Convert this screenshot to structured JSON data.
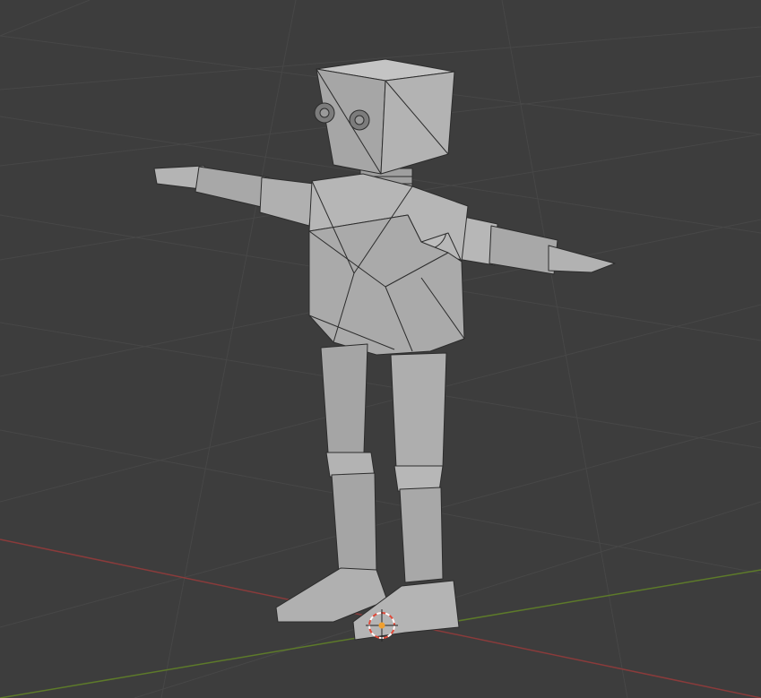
{
  "viewport": {
    "background_color": "#3d3d3d",
    "grid_line_color": "#474747",
    "x_axis_color": "#8a3b3b",
    "y_axis_color": "#5d7a2a"
  },
  "model": {
    "face_color": "#a9a9a9",
    "face_light_color": "#bcbcbc",
    "face_dark_color": "#8e8e8e",
    "edge_color": "#2c2c2c"
  },
  "origin_marker": {
    "icon": "3d-cursor-icon",
    "ring_color": "#e04a3a",
    "dash_color": "#ffffff",
    "dot_color": "#f0a030"
  }
}
